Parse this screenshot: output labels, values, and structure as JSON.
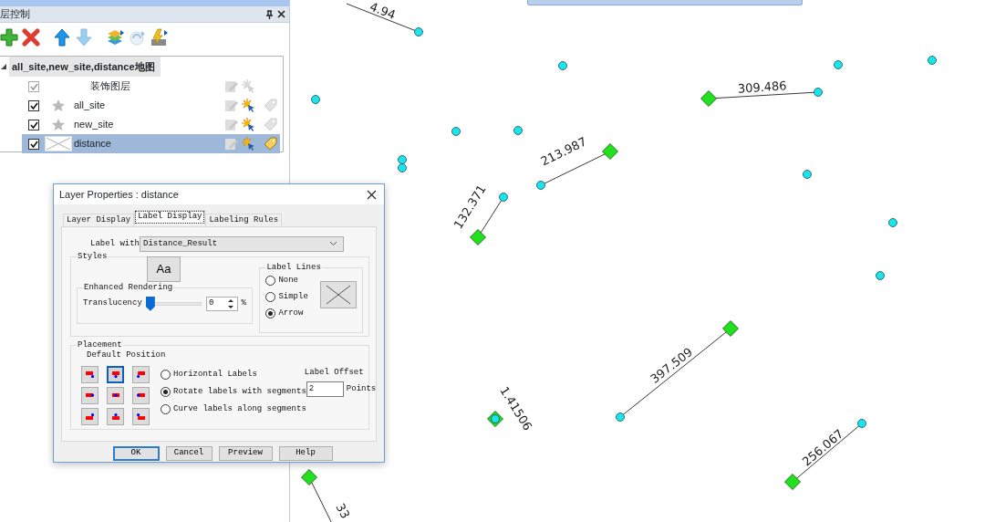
{
  "panel": {
    "title": "层控制",
    "toolbar": [
      {
        "kind": "add",
        "disabled": false
      },
      {
        "kind": "remove",
        "disabled": false
      },
      {
        "kind": "up",
        "disabled": false
      },
      {
        "kind": "down",
        "disabled": true
      },
      {
        "kind": "layers",
        "disabled": false
      },
      {
        "kind": "refresh",
        "disabled": true
      },
      {
        "kind": "properties",
        "disabled": false
      }
    ],
    "tree": {
      "label": "all_site,new_site,distance地图",
      "expanded": true,
      "children": [
        {
          "label": "装饰图层",
          "kind": "decor",
          "checked": true,
          "disabled": true,
          "selected": false
        },
        {
          "label": "all_site",
          "kind": "point",
          "checked": true,
          "disabled": false,
          "selected": false,
          "labeled": false
        },
        {
          "label": "new_site",
          "kind": "point",
          "checked": true,
          "disabled": false,
          "selected": false,
          "labeled": false
        },
        {
          "label": "distance",
          "kind": "line",
          "checked": true,
          "disabled": false,
          "selected": true,
          "labeled": true
        }
      ]
    }
  },
  "map": {
    "labels": [
      "4.94",
      "309.486",
      "213.987",
      "132.371",
      "397.509",
      "256.067",
      "33",
      "1.41506"
    ]
  },
  "dialog": {
    "title": "Layer Properties  : distance",
    "tabs": [
      {
        "label": "Layer Display",
        "selected": false
      },
      {
        "label": "Label Display",
        "selected": true
      },
      {
        "label": "Labeling Rules",
        "selected": false
      }
    ],
    "label_with": {
      "label": "Label with",
      "value": "Distance_Result"
    },
    "styles": {
      "title": "Styles",
      "font_button": "Aa",
      "enhanced": {
        "title": "Enhanced Rendering",
        "label": "Translucency",
        "level": 0,
        "value": "0",
        "unit": "%"
      }
    },
    "label_lines": {
      "title": "Label Lines",
      "options": [
        {
          "label": "None",
          "selected": false
        },
        {
          "label": "Simple",
          "selected": false
        },
        {
          "label": "Arrow",
          "selected": true
        }
      ]
    },
    "placement": {
      "title": "Placement",
      "default_position": "Default Position",
      "positions": [
        {
          "selected": false
        },
        {
          "selected": true
        },
        {
          "selected": false
        },
        {
          "selected": false
        },
        {
          "selected": false
        },
        {
          "selected": false
        },
        {
          "selected": false
        },
        {
          "selected": false
        },
        {
          "selected": false
        }
      ],
      "orientation": [
        {
          "label": "Horizontal Labels",
          "selected": false
        },
        {
          "label": "Rotate labels with segments",
          "selected": true
        },
        {
          "label": "Curve labels along segments",
          "selected": false
        }
      ],
      "offset": {
        "title": "Label Offset",
        "value": "2",
        "unit": "Points"
      }
    },
    "buttons": [
      {
        "label": "OK",
        "default": true
      },
      {
        "label": "Cancel",
        "default": false
      },
      {
        "label": "Preview",
        "default": false
      },
      {
        "label": "Help",
        "default": false
      }
    ]
  }
}
